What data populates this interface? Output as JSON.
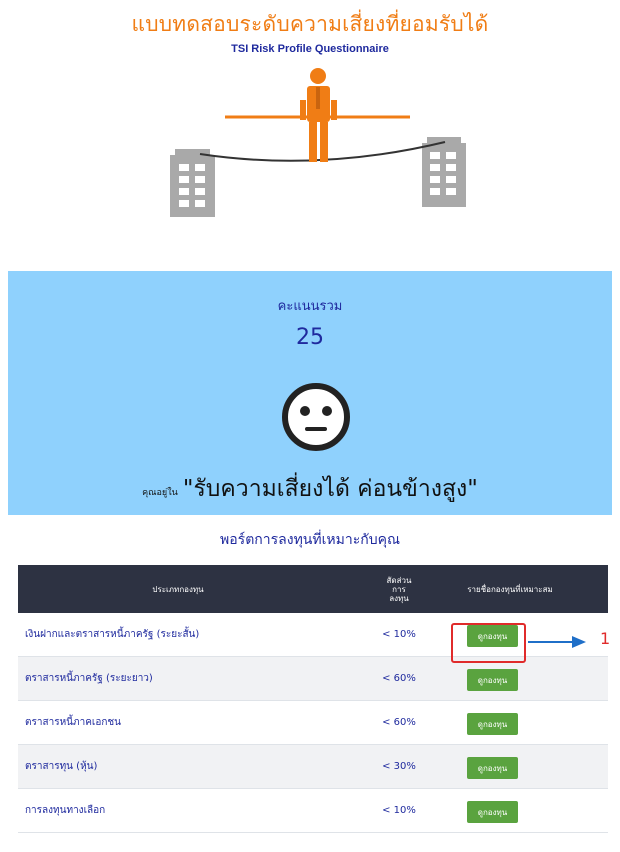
{
  "header": {
    "title": "แบบทดสอบระดับความเสี่ยงที่ยอมรับได้",
    "subtitle": "TSI Risk Profile Questionnaire"
  },
  "result_panel": {
    "score_label": "คะแนนรวม",
    "score_value": "25",
    "result_prefix": "คุณอยู่ใน",
    "risk_level": "\"รับความเสี่ยงได้ ค่อนข้างสูง\"",
    "face_icon": "neutral-face-icon",
    "background_color": "#8fd1fd"
  },
  "portfolio": {
    "title": "พอร์ตการลงทุนที่เหมาะกับคุณ",
    "columns": {
      "asset_type": "ประเภทกองทุน",
      "allocation": "สัดส่วน การ ลงทุน",
      "funds": "รายชื่อกองทุนที่เหมาะสม"
    },
    "rows": [
      {
        "asset": "เงินฝากและตราสารหนี้ภาครัฐ (ระยะสั้น)",
        "ratio": "< 10%",
        "button": "ดูกองทุน"
      },
      {
        "asset": "ตราสารหนี้ภาครัฐ (ระยะยาว)",
        "ratio": "< 60%",
        "button": "ดูกองทุน"
      },
      {
        "asset": "ตราสารหนี้ภาคเอกชน",
        "ratio": "< 60%",
        "button": "ดูกองทุน"
      },
      {
        "asset": "ตราสารทุน (หุ้น)",
        "ratio": "< 30%",
        "button": "ดูกองทุน"
      },
      {
        "asset": "การลงทุนทางเลือก",
        "ratio": "< 10%",
        "button": "ดูกองทุน"
      }
    ]
  },
  "annotation": {
    "callout_number": "1",
    "highlight_color": "#e02b2b",
    "arrow_color": "#1f6fc8"
  },
  "colors": {
    "title_orange": "#f07d15",
    "text_blue": "#1f2a9e",
    "button_green": "#5aa33f",
    "header_dark": "#2d3242"
  }
}
